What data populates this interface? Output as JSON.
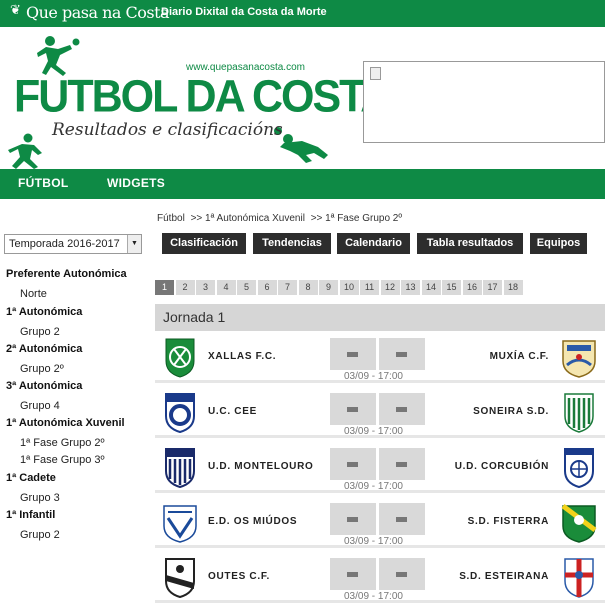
{
  "topbar": {
    "brand": "Que pasa na Costa",
    "tagline": "Diario Dixital da Costa da Morte"
  },
  "header": {
    "url": "www.quepasanacosta.com",
    "title": "FUTBOL DA COSTA",
    "subtitle": "Resultados e clasificacións"
  },
  "nav": {
    "items": [
      "FÚTBOL",
      "WIDGETS"
    ]
  },
  "breadcrumb": [
    "Fútbol",
    ">> 1ª Autonómica Xuvenil",
    ">> 1ª Fase Grupo 2º"
  ],
  "season": {
    "selected": "Temporada 2016-2017"
  },
  "sidebar": {
    "sections": [
      {
        "label": "Preferente Autonómica",
        "items": [
          "Norte"
        ]
      },
      {
        "label": "1ª Autonómica",
        "items": [
          "Grupo 2"
        ]
      },
      {
        "label": "2ª Autonómica",
        "items": [
          "Grupo 2º"
        ]
      },
      {
        "label": "3ª Autonómica",
        "items": [
          "Grupo 4"
        ]
      },
      {
        "label": "1ª Autonómica Xuvenil",
        "items": [
          "1ª Fase Grupo 2º",
          "1ª Fase Grupo 3º"
        ]
      },
      {
        "label": "1ª Cadete",
        "items": [
          "Grupo 3"
        ]
      },
      {
        "label": "1ª Infantil",
        "items": [
          "Grupo 2"
        ]
      }
    ]
  },
  "tabs": [
    "Clasificación",
    "Tendencias",
    "Calendario",
    "Tabla resultados",
    "Equipos"
  ],
  "rounds": {
    "active": 1,
    "labels": [
      "1",
      "2",
      "3",
      "4",
      "5",
      "6",
      "7",
      "8",
      "9",
      "10",
      "11",
      "12",
      "13",
      "14",
      "15",
      "16",
      "17",
      "18"
    ]
  },
  "jornada": {
    "title": "Jornada 1"
  },
  "matches": [
    {
      "home": "XALLAS F.C.",
      "away": "MUXÍA C.F.",
      "time": "03/09 - 17:00"
    },
    {
      "home": "U.C. CEE",
      "away": "SONEIRA S.D.",
      "time": "03/09 - 17:00"
    },
    {
      "home": "U.D. MONTELOURO",
      "away": "U.D. CORCUBIÓN",
      "time": "03/09 - 17:00"
    },
    {
      "home": "E.D. OS MIÚDOS",
      "away": "S.D. FISTERRA",
      "time": "03/09 - 17:00"
    },
    {
      "home": "OUTES C.F.",
      "away": "S.D. ESTEIRANA",
      "time": "03/09 - 17:00"
    }
  ],
  "colors": {
    "brand_green": "#0e8a45",
    "tab_dark": "#2d2d2d",
    "panel_grey": "#d6d6d6"
  }
}
